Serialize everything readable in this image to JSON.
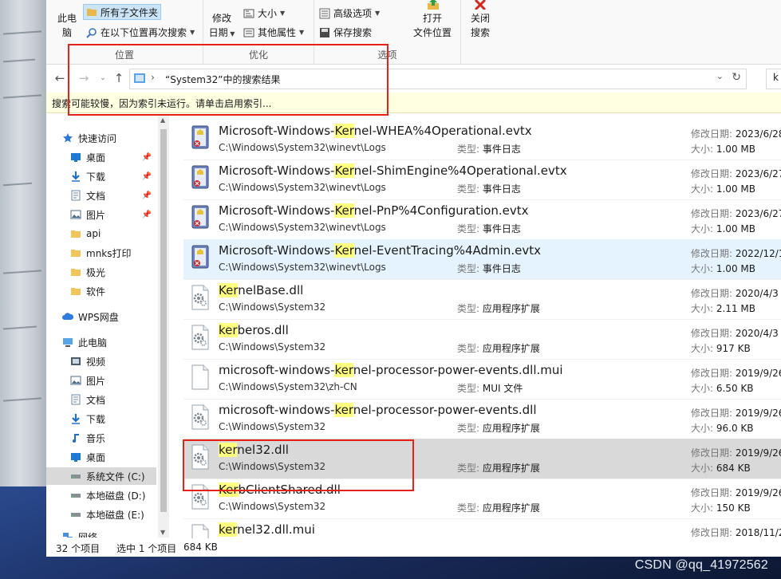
{
  "ribbon": {
    "this_pc_label": [
      "此电",
      "脑"
    ],
    "include_subfolders": "所有子文件夹",
    "search_again_in": "在以下位置再次搜索",
    "date_modified": [
      "修改",
      "日期"
    ],
    "size": "大小",
    "other_properties": "其他属性",
    "advanced_options": "高级选项",
    "save_search": "保存搜索",
    "open_location": [
      "打开",
      "文件位置"
    ],
    "close_search": [
      "关闭",
      "搜索"
    ],
    "group_location": "位置",
    "group_refine": "优化",
    "group_options": "选项"
  },
  "address": {
    "path": "“System32”中的搜索结果",
    "search_fragment": "k"
  },
  "infobar": "搜索可能较慢，因为索引未运行。请单击启用索引...",
  "nav": {
    "items": [
      {
        "label": "快速访问",
        "icon": "star-icon",
        "pinned": false
      },
      {
        "label": "桌面",
        "icon": "desktop-icon",
        "pinned": true
      },
      {
        "label": "下载",
        "icon": "download-icon",
        "pinned": true
      },
      {
        "label": "文档",
        "icon": "document-icon",
        "pinned": true
      },
      {
        "label": "图片",
        "icon": "picture-icon",
        "pinned": true
      },
      {
        "label": "api",
        "icon": "folder-icon",
        "pinned": false
      },
      {
        "label": "mnks打印",
        "icon": "folder-icon",
        "pinned": false
      },
      {
        "label": "极光",
        "icon": "folder-icon",
        "pinned": false
      },
      {
        "label": "软件",
        "icon": "folder-icon",
        "pinned": false
      },
      {
        "label": "WPS网盘",
        "icon": "cloud-icon",
        "pinned": false
      },
      {
        "label": "此电脑",
        "icon": "computer-icon",
        "pinned": false
      },
      {
        "label": "视频",
        "icon": "video-icon",
        "pinned": false
      },
      {
        "label": "图片",
        "icon": "picture-icon",
        "pinned": false
      },
      {
        "label": "文档",
        "icon": "document-icon",
        "pinned": false
      },
      {
        "label": "下载",
        "icon": "download-icon",
        "pinned": false
      },
      {
        "label": "音乐",
        "icon": "music-icon",
        "pinned": false
      },
      {
        "label": "桌面",
        "icon": "desktop-icon",
        "pinned": false
      },
      {
        "label": "系统文件 (C:)",
        "icon": "drive-icon",
        "pinned": false
      },
      {
        "label": "本地磁盘 (D:)",
        "icon": "drive-icon",
        "pinned": false
      },
      {
        "label": "本地磁盘 (E:)",
        "icon": "drive-icon",
        "pinned": false
      },
      {
        "label": "网络",
        "icon": "network-icon",
        "pinned": false
      }
    ]
  },
  "labels": {
    "date": "修改日期: ",
    "size": "大小: ",
    "type": "类型: "
  },
  "files": [
    {
      "pre": "Microsoft-Windows-",
      "hl": "Ker",
      "post": "nel-WHEA%4Operational.evtx",
      "path": "C:\\Windows\\System32\\winevt\\Logs",
      "type": "事件日志",
      "date": "2023/6/28",
      "size": "1.00 MB",
      "icon": "event-log-icon"
    },
    {
      "pre": "Microsoft-Windows-",
      "hl": "Ker",
      "post": "nel-ShimEngine%4Operational.evtx",
      "path": "C:\\Windows\\System32\\winevt\\Logs",
      "type": "事件日志",
      "date": "2023/6/27",
      "size": "1.00 MB",
      "icon": "event-log-icon"
    },
    {
      "pre": "Microsoft-Windows-",
      "hl": "Ker",
      "post": "nel-PnP%4Configuration.evtx",
      "path": "C:\\Windows\\System32\\winevt\\Logs",
      "type": "事件日志",
      "date": "2023/6/27",
      "size": "1.00 MB",
      "icon": "event-log-icon"
    },
    {
      "pre": "Microsoft-Windows-",
      "hl": "Ker",
      "post": "nel-EventTracing%4Admin.evtx",
      "path": "C:\\Windows\\System32\\winevt\\Logs",
      "type": "事件日志",
      "date": "2022/12/1",
      "size": "1.00 MB",
      "icon": "event-log-icon"
    },
    {
      "pre": "",
      "hl": "Ker",
      "post": "nelBase.dll",
      "path": "C:\\Windows\\System32",
      "type": "应用程序扩展",
      "date": "2020/4/3",
      "size": "2.11 MB",
      "icon": "dll-gear-icon"
    },
    {
      "pre": "",
      "hl": "ker",
      "post": "beros.dll",
      "path": "C:\\Windows\\System32",
      "type": "应用程序扩展",
      "date": "2020/4/3",
      "size": "917 KB",
      "icon": "dll-gear-icon"
    },
    {
      "pre": "microsoft-windows-",
      "hl": "ker",
      "post": "nel-processor-power-events.dll.mui",
      "path": "C:\\Windows\\System32\\zh-CN",
      "type": "MUI 文件",
      "date": "2019/9/26",
      "size": "6.50 KB",
      "icon": "blank-file-icon"
    },
    {
      "pre": "microsoft-windows-",
      "hl": "ker",
      "post": "nel-processor-power-events.dll",
      "path": "C:\\Windows\\System32",
      "type": "应用程序扩展",
      "date": "2019/9/26",
      "size": "96.0 KB",
      "icon": "dll-gear-icon"
    },
    {
      "pre": "",
      "hl": "ker",
      "post": "nel32.dll",
      "path": "C:\\Windows\\System32",
      "type": "应用程序扩展",
      "date": "2019/9/26",
      "size": "684 KB",
      "icon": "dll-gear-icon"
    },
    {
      "pre": "",
      "hl": "Ker",
      "post": "bClientShared.dll",
      "path": "C:\\Windows\\System32",
      "type": "应用程序扩展",
      "date": "2019/9/26",
      "size": "150 KB",
      "icon": "dll-gear-icon"
    },
    {
      "pre": "",
      "hl": "ker",
      "post": "nel32.dll.mui",
      "path": "",
      "type": "",
      "date": "2018/11/2",
      "size": "",
      "icon": "blank-file-icon"
    }
  ],
  "status": {
    "count": "32 个项目",
    "selected": "选中 1 个项目",
    "selected_size": "684 KB"
  },
  "watermark": "CSDN @qq_41972562",
  "colors": {
    "accent": "#0078d7",
    "highlight": "#ffff80",
    "selection": "#d9d9d9",
    "hover": "#e5f3ff",
    "annotation": "#e3221a"
  }
}
